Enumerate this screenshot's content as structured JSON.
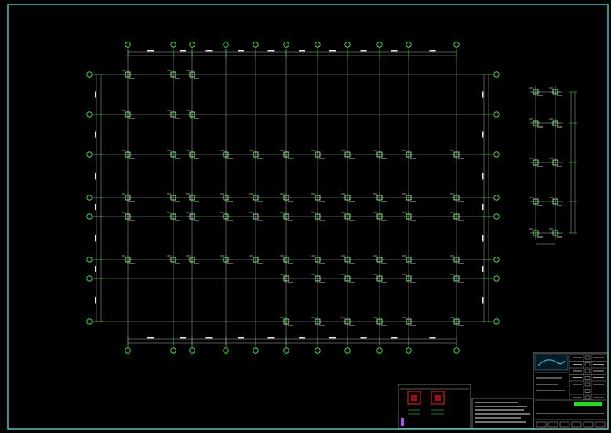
{
  "drawing": {
    "colors": {
      "background": "#000000",
      "frame": "#3fd6d6",
      "grid": "#d8d8d8",
      "axis_bubble": "#3cff3c",
      "column": "#ffffff",
      "rebar": "#2bff2b",
      "title": "#31e06a",
      "section_fill": "#ff2020",
      "logo_block": "#30a8d0"
    },
    "title": "",
    "scale": "",
    "column_legend": {
      "items": [
        {
          "name": "column-section-type-a"
        },
        {
          "name": "column-section-type-b"
        }
      ]
    },
    "notes": {
      "lines": [
        "",
        "",
        "",
        "",
        ""
      ]
    },
    "title_block": {
      "company": "",
      "project": "",
      "drawing_name": "",
      "drawing_number": ""
    }
  }
}
